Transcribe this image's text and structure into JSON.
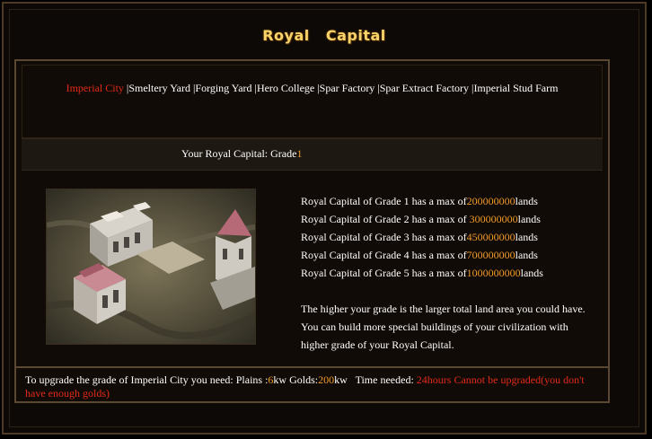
{
  "header": {
    "title_word1": "Royal",
    "title_word2": "Capital"
  },
  "nav": {
    "items": [
      "Imperial City",
      "Smeltery Yard",
      "Forging Yard",
      "Hero College",
      "Spar Factory",
      "Spar Extract Factory",
      "Imperial Stud Farm"
    ],
    "active_index": 0
  },
  "grade": {
    "label": "Your Royal Capital: Grade",
    "value": "1"
  },
  "grades": [
    {
      "prefix": "Royal Capital of Grade 1 has a max of",
      "value": "200000000",
      "suffix": "lands"
    },
    {
      "prefix": "Royal Capital of Grade 2 has a max of ",
      "value": "300000000",
      "suffix": "lands"
    },
    {
      "prefix": "Royal Capital of Grade 3 has a max of",
      "value": "450000000",
      "suffix": "lands"
    },
    {
      "prefix": "Royal Capital of Grade 4 has a max of",
      "value": "700000000",
      "suffix": "lands"
    },
    {
      "prefix": "Royal Capital of Grade 5 has a max of",
      "value": "1000000000",
      "suffix": "lands"
    }
  ],
  "description": {
    "line1": "The higher your grade is the larger total land area you could have.",
    "line2": "You can build more special buildings of your civilization with",
    "line3": "higher grade of your Royal Capital."
  },
  "upgrade": {
    "intro": "To upgrade the grade of Imperial City you need: Plains :",
    "plains": "6",
    "kw1": "kw Golds:",
    "golds": "200",
    "kw2": "kw",
    "time_label": "Time needed: ",
    "time": "24hours",
    "warning": "Cannot be upgraded(you don't have enough golds)"
  },
  "colors": {
    "accent": "#f09a28",
    "alert": "#e42a18",
    "title": "#f7d36a",
    "border": "#5a4832"
  },
  "image": {
    "icon": "royal-capital-building-illustration"
  }
}
